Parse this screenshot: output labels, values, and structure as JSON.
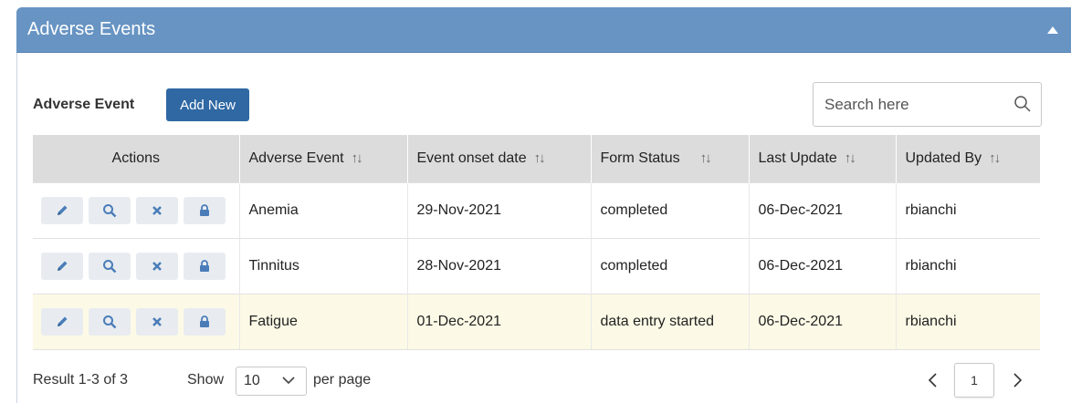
{
  "panel": {
    "title": "Adverse Events"
  },
  "section": {
    "label": "Adverse Event",
    "add_button": "Add New"
  },
  "search": {
    "placeholder": "Search here"
  },
  "table": {
    "columns": [
      "Actions",
      "Adverse Event",
      "Event onset date",
      "Form Status",
      "Last Update",
      "Updated By"
    ],
    "rows": [
      {
        "event": "Anemia",
        "onset": "29-Nov-2021",
        "status": "completed",
        "last_update": "06-Dec-2021",
        "updated_by": "rbianchi"
      },
      {
        "event": "Tinnitus",
        "onset": "28-Nov-2021",
        "status": "completed",
        "last_update": "06-Dec-2021",
        "updated_by": "rbianchi"
      },
      {
        "event": "Fatigue",
        "onset": "01-Dec-2021",
        "status": "data entry started",
        "last_update": "06-Dec-2021",
        "updated_by": "rbianchi"
      }
    ],
    "action_icons": [
      "pencil-icon",
      "magnifier-icon",
      "x-icon",
      "lock-icon"
    ],
    "sort_icon": "↑↓"
  },
  "footer": {
    "result": "Result 1-3 of 3",
    "show": "Show",
    "page_size": "10",
    "per_page": "per page",
    "current_page": "1"
  },
  "colors": {
    "header": "#6794c3",
    "button": "#2f68a3",
    "icon": "#4a7db8",
    "highlight_row": "#fcfae6"
  }
}
